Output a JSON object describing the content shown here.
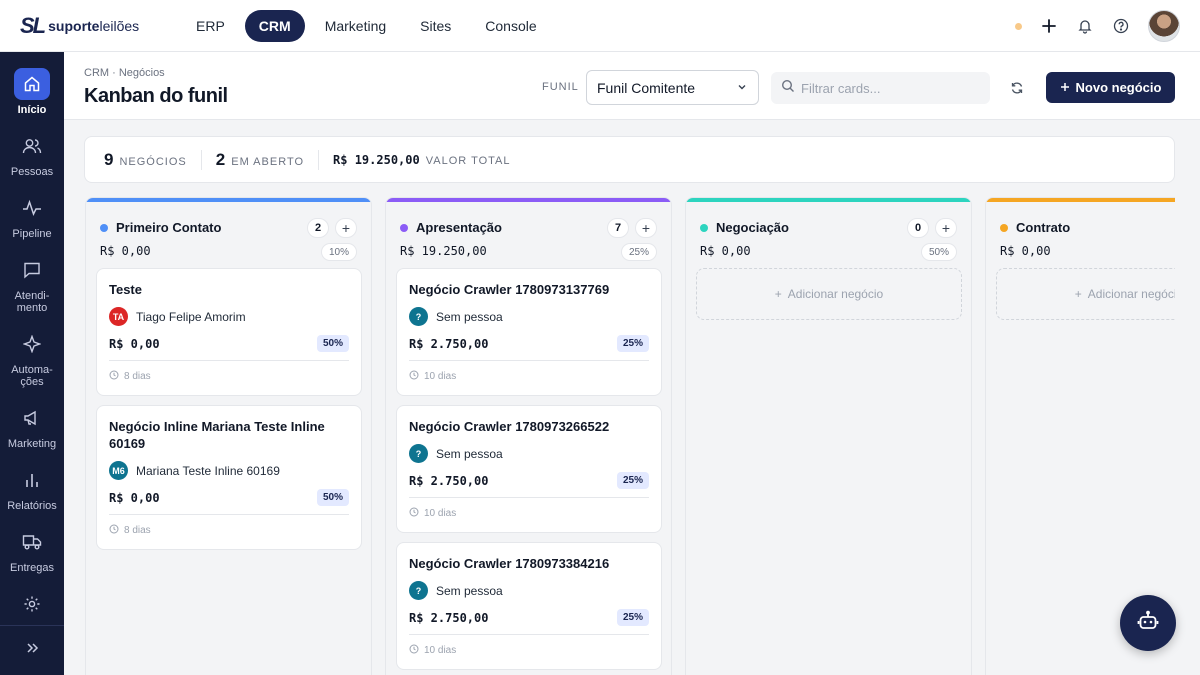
{
  "brand": {
    "mark": "SL",
    "name_bold": "suporte",
    "name_rest": "leilões"
  },
  "topnav": [
    {
      "label": "ERP",
      "active": false
    },
    {
      "label": "CRM",
      "active": true
    },
    {
      "label": "Marketing",
      "active": false
    },
    {
      "label": "Sites",
      "active": false
    },
    {
      "label": "Console",
      "active": false
    }
  ],
  "sidebar": [
    {
      "label": "Início",
      "icon": "home-icon",
      "active": true
    },
    {
      "label": "Pessoas",
      "icon": "users-icon"
    },
    {
      "label": "Pipeline",
      "icon": "pulse-icon"
    },
    {
      "label": "Atendi-mento",
      "icon": "chat-icon"
    },
    {
      "label": "Automa-ções",
      "icon": "sparkle-icon"
    },
    {
      "label": "Marketing",
      "icon": "megaphone-icon"
    },
    {
      "label": "Relatórios",
      "icon": "bar-chart-icon"
    },
    {
      "label": "Entregas",
      "icon": "truck-icon"
    },
    {
      "label": "",
      "icon": "gear-icon"
    }
  ],
  "header": {
    "breadcrumb": "CRM · Negócios",
    "title": "Kanban do funil",
    "funil_label": "FUNIL",
    "funil_value": "Funil Comitente",
    "search_placeholder": "Filtrar cards...",
    "new_button": "Novo negócio"
  },
  "stats": {
    "deals_count": "9",
    "deals_label": "NEGÓCIOS",
    "open_count": "2",
    "open_label": "EM ABERTO",
    "total_value": "R$ 19.250,00",
    "total_label": "VALOR TOTAL"
  },
  "columns": [
    {
      "name": "Primeiro Contato",
      "color": "#4f8ff7",
      "count": "2",
      "total": "R$ 0,00",
      "pct": "10%",
      "cards": [
        {
          "title": "Teste",
          "person": "Tiago Felipe Amorim",
          "initials": "TA",
          "avatar_color": "#dc2626",
          "value": "R$ 0,00",
          "pct": "50%",
          "days": "8 dias"
        },
        {
          "title": "Negócio Inline Mariana Teste Inline 60169",
          "person": "Mariana Teste Inline 60169",
          "initials": "M6",
          "avatar_color": "#0e7490",
          "value": "R$ 0,00",
          "pct": "50%",
          "days": "8 dias"
        }
      ]
    },
    {
      "name": "Apresentação",
      "color": "#8b5cf6",
      "count": "7",
      "total": "R$ 19.250,00",
      "pct": "25%",
      "cards": [
        {
          "title": "Negócio Crawler 1780973137769",
          "person": "Sem pessoa",
          "initials": "?",
          "avatar_color": "#0e7490",
          "value": "R$ 2.750,00",
          "pct": "25%",
          "days": "10 dias"
        },
        {
          "title": "Negócio Crawler 1780973266522",
          "person": "Sem pessoa",
          "initials": "?",
          "avatar_color": "#0e7490",
          "value": "R$ 2.750,00",
          "pct": "25%",
          "days": "10 dias"
        },
        {
          "title": "Negócio Crawler 1780973384216",
          "person": "Sem pessoa",
          "initials": "?",
          "avatar_color": "#0e7490",
          "value": "R$ 2.750,00",
          "pct": "25%",
          "days": "10 dias"
        }
      ]
    },
    {
      "name": "Negociação",
      "color": "#2dd4bf",
      "count": "0",
      "total": "R$ 0,00",
      "pct": "50%",
      "add_label": "Adicionar negócio",
      "cards": []
    },
    {
      "name": "Contrato",
      "color": "#f5a623",
      "count": "",
      "total": "R$ 0,00",
      "pct": "",
      "add_label": "Adicionar negócio",
      "cards": []
    }
  ]
}
